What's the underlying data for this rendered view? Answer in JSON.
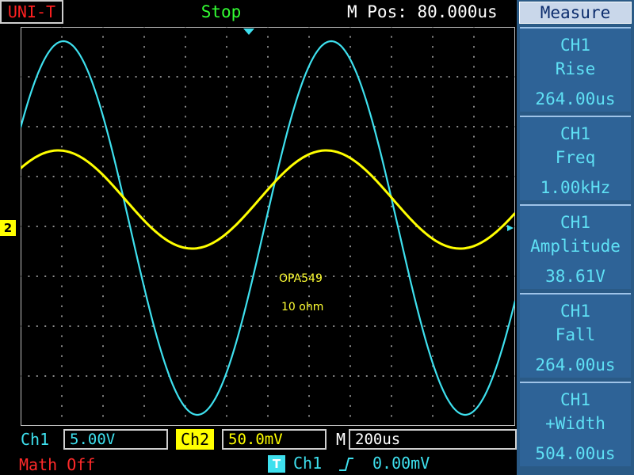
{
  "header": {
    "brand": "UNI-T",
    "status": "Stop",
    "mpos": "M Pos: 80.000us"
  },
  "measure": {
    "title": "Measure",
    "items": [
      {
        "channel": "CH1",
        "name": "Rise",
        "value": "264.00us"
      },
      {
        "channel": "CH1",
        "name": "Freq",
        "value": "1.00kHz"
      },
      {
        "channel": "CH1",
        "name": "Amplitude",
        "value": "38.61V"
      },
      {
        "channel": "CH1",
        "name": "Fall",
        "value": "264.00us"
      },
      {
        "channel": "CH1",
        "name": "+Width",
        "value": "504.00us"
      }
    ]
  },
  "screen": {
    "annotations": [
      "OPA549",
      "10 ohm"
    ],
    "ch2_marker": "2",
    "ch1_color": "#3ee0ee",
    "ch2_color": "#ffff00"
  },
  "footer": {
    "ch1_label": "Ch1",
    "ch1_scale": "5.00V",
    "ch2_label": "Ch2",
    "ch2_scale": "50.0mV",
    "time_label": "M",
    "time_scale": "200us",
    "math": "Math Off",
    "trigger_badge": "T",
    "trigger_source": "Ch1",
    "trigger_slope_icon": "rising-edge",
    "trigger_level": "0.00mV"
  }
}
